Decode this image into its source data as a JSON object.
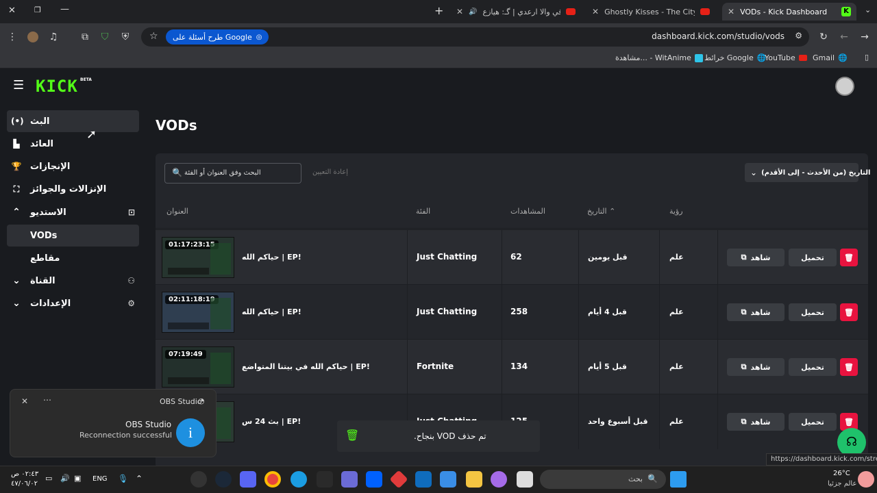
{
  "browser": {
    "tabs": [
      {
        "title": "VODs - Kick Dashboard",
        "active": true
      },
      {
        "title": "Ghostly Kisses - The City Holds",
        "active": false
      },
      {
        "title": "ابرقي والا ارعدي | گـ: هيازع",
        "active": false
      }
    ],
    "url": "dashboard.kick.com/studio/vods",
    "google_chip": "طرح أسئلة على Google",
    "bookmarks": [
      "Gmail",
      "YouTube",
      "خرائط Google",
      "مشاهدة... - WitAnime"
    ]
  },
  "kick": {
    "logo": "KICK",
    "logo_badge": "BETA",
    "page_title": "VODs",
    "accent": "#53fc18"
  },
  "sidebar": {
    "items": [
      {
        "label": "البث",
        "icon": "broadcast-icon"
      },
      {
        "label": "العائد",
        "icon": "revenue-icon"
      },
      {
        "label": "الإنجازات",
        "icon": "trophy-icon"
      },
      {
        "label": "الإنزالات والجوائز",
        "icon": "drops-icon"
      },
      {
        "label": "الاستديو",
        "icon": "studio-icon"
      },
      {
        "label": "VODs",
        "icon": ""
      },
      {
        "label": "مقاطع",
        "icon": ""
      },
      {
        "label": "القناة",
        "icon": "channel-icon"
      },
      {
        "label": "الإعدادات",
        "icon": "gear-icon"
      }
    ]
  },
  "filters": {
    "search_placeholder": "البحث وفق العنوان أو الفئة",
    "reset_label": "إعادة التعيين",
    "sort_label": "التاريخ (من الأحدث - إلى الأقدم)"
  },
  "table": {
    "headers": {
      "title": "العنوان",
      "category": "الفئة",
      "views": "المشاهدات",
      "date": "التاريخ",
      "visibility": "رؤية"
    },
    "watch_label": "شاهد",
    "download_label": "تحميل",
    "rows": [
      {
        "duration": "01:17:23:15",
        "title": "حياكم الله | EP!",
        "category": "Just Chatting",
        "views": "62",
        "date": "قبل يومين",
        "visibility": "علم"
      },
      {
        "duration": "02:11:18:19",
        "title": "حياكم الله | EP!",
        "category": "Just Chatting",
        "views": "258",
        "date": "قبل 4 أيام",
        "visibility": "علم"
      },
      {
        "duration": "07:19:49",
        "title": "حياكم الله في بيتنا المتواضع | EP!",
        "category": "Fortnite",
        "views": "134",
        "date": "قبل 5 أيام",
        "visibility": "علم"
      },
      {
        "duration": "",
        "title": "بث 24 س | EP!",
        "category": "Just Chatting",
        "views": "125",
        "date": "قبل أسبوع واحد",
        "visibility": "علم"
      }
    ]
  },
  "toast": {
    "message": ".بنجاح VOD تم حذف"
  },
  "notification": {
    "app": "OBS Studio",
    "title": "OBS Studio",
    "body": "Reconnection successful"
  },
  "status_url": "https://dashboard.kick.com/stream",
  "taskbar": {
    "search_placeholder": "بحث",
    "weather_temp": "26°C",
    "weather_desc": "عالم جزئيا",
    "lang": "ENG",
    "time": "٠٢:٤٣ ص",
    "date": "٤٧/٠٦/٠٢"
  }
}
